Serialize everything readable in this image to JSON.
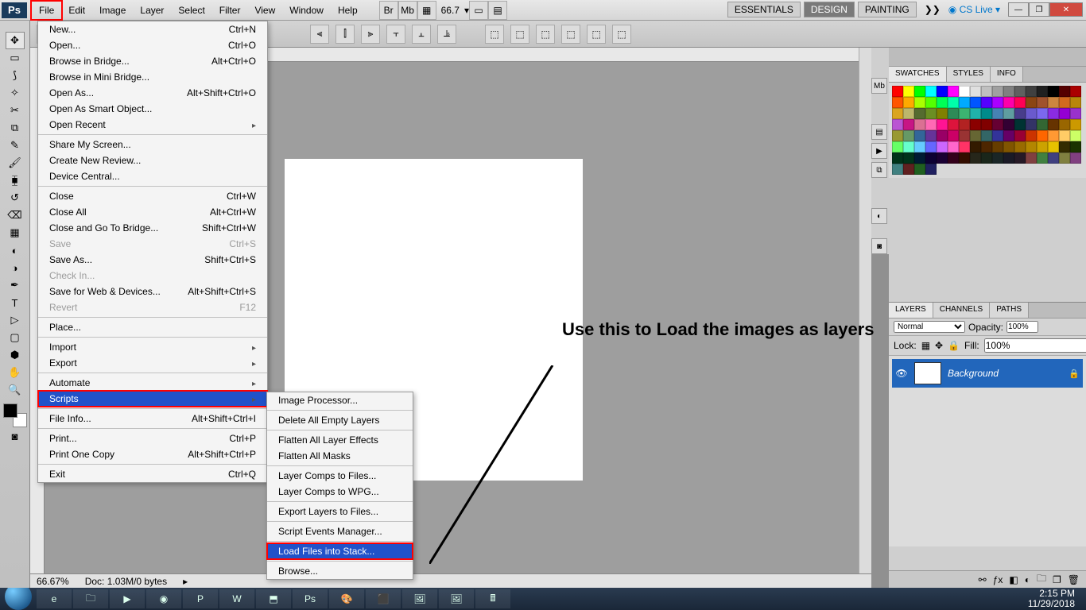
{
  "app": {
    "logo": "Ps"
  },
  "menu": [
    "File",
    "Edit",
    "Image",
    "Layer",
    "Select",
    "Filter",
    "View",
    "Window",
    "Help"
  ],
  "menu_highlight_index": 0,
  "toolbar_top": {
    "zoom": "66.7"
  },
  "workspaces": [
    "ESSENTIALS",
    "DESIGN",
    "PAINTING"
  ],
  "cslive": "CS Live",
  "file_menu": [
    {
      "label": "New...",
      "hotkey": "Ctrl+N"
    },
    {
      "label": "Open...",
      "hotkey": "Ctrl+O"
    },
    {
      "label": "Browse in Bridge...",
      "hotkey": "Alt+Ctrl+O"
    },
    {
      "label": "Browse in Mini Bridge..."
    },
    {
      "label": "Open As...",
      "hotkey": "Alt+Shift+Ctrl+O"
    },
    {
      "label": "Open As Smart Object..."
    },
    {
      "label": "Open Recent",
      "submenu": true
    },
    {
      "sep": true
    },
    {
      "label": "Share My Screen..."
    },
    {
      "label": "Create New Review..."
    },
    {
      "label": "Device Central..."
    },
    {
      "sep": true
    },
    {
      "label": "Close",
      "hotkey": "Ctrl+W"
    },
    {
      "label": "Close All",
      "hotkey": "Alt+Ctrl+W"
    },
    {
      "label": "Close and Go To Bridge...",
      "hotkey": "Shift+Ctrl+W"
    },
    {
      "label": "Save",
      "hotkey": "Ctrl+S",
      "disabled": true
    },
    {
      "label": "Save As...",
      "hotkey": "Shift+Ctrl+S"
    },
    {
      "label": "Check In...",
      "disabled": true
    },
    {
      "label": "Save for Web & Devices...",
      "hotkey": "Alt+Shift+Ctrl+S"
    },
    {
      "label": "Revert",
      "hotkey": "F12",
      "disabled": true
    },
    {
      "sep": true
    },
    {
      "label": "Place..."
    },
    {
      "sep": true
    },
    {
      "label": "Import",
      "submenu": true
    },
    {
      "label": "Export",
      "submenu": true
    },
    {
      "sep": true
    },
    {
      "label": "Automate",
      "submenu": true
    },
    {
      "label": "Scripts",
      "submenu": true,
      "highlight": true
    },
    {
      "sep": true
    },
    {
      "label": "File Info...",
      "hotkey": "Alt+Shift+Ctrl+I"
    },
    {
      "sep": true
    },
    {
      "label": "Print...",
      "hotkey": "Ctrl+P"
    },
    {
      "label": "Print One Copy",
      "hotkey": "Alt+Shift+Ctrl+P"
    },
    {
      "sep": true
    },
    {
      "label": "Exit",
      "hotkey": "Ctrl+Q"
    }
  ],
  "scripts_submenu": [
    {
      "label": "Image Processor..."
    },
    {
      "sep": true
    },
    {
      "label": "Delete All Empty Layers"
    },
    {
      "sep": true
    },
    {
      "label": "Flatten All Layer Effects"
    },
    {
      "label": "Flatten All Masks"
    },
    {
      "sep": true
    },
    {
      "label": "Layer Comps to Files..."
    },
    {
      "label": "Layer Comps to WPG..."
    },
    {
      "sep": true
    },
    {
      "label": "Export Layers to Files..."
    },
    {
      "sep": true
    },
    {
      "label": "Script Events Manager..."
    },
    {
      "sep": true
    },
    {
      "label": "Load Files into Stack...",
      "highlight": true
    },
    {
      "sep": true
    },
    {
      "label": "Browse..."
    }
  ],
  "annotation": "Use this to Load the images as layers",
  "panels": {
    "swatches_tabs": [
      "SWATCHES",
      "STYLES",
      "INFO"
    ],
    "layers_tabs": [
      "LAYERS",
      "CHANNELS",
      "PATHS"
    ],
    "blend": "Normal",
    "opacity_label": "Opacity:",
    "opacity": "100%",
    "lock_label": "Lock:",
    "fill_label": "Fill:",
    "fill": "100%",
    "bg_layer": "Background"
  },
  "swatch_colors": [
    "#ff0000",
    "#ffff00",
    "#00ff00",
    "#00ffff",
    "#0000ff",
    "#ff00ff",
    "#ffffff",
    "#e0e0e0",
    "#c0c0c0",
    "#a0a0a0",
    "#808080",
    "#606060",
    "#404040",
    "#202020",
    "#000000",
    "#550000",
    "#aa0000",
    "#ff5500",
    "#ffaa00",
    "#aaff00",
    "#55ff00",
    "#00ff55",
    "#00ffaa",
    "#00aaff",
    "#0055ff",
    "#5500ff",
    "#aa00ff",
    "#ff00aa",
    "#ff0055",
    "#8b4513",
    "#a0522d",
    "#cd853f",
    "#d2691e",
    "#b8860b",
    "#daa520",
    "#bdb76b",
    "#556b2f",
    "#6b8e23",
    "#808000",
    "#2e8b57",
    "#3cb371",
    "#20b2aa",
    "#008b8b",
    "#4682b4",
    "#5f9ea0",
    "#483d8b",
    "#6a5acd",
    "#7b68ee",
    "#8a2be2",
    "#9400d3",
    "#9932cc",
    "#ba55d3",
    "#c71585",
    "#db7093",
    "#ff69b4",
    "#ff1493",
    "#dc143c",
    "#b22222",
    "#8b0000",
    "#800000",
    "#660033",
    "#330033",
    "#003333",
    "#333366",
    "#336633",
    "#663300",
    "#996600",
    "#cc9900",
    "#999933",
    "#669966",
    "#336699",
    "#663399",
    "#990066",
    "#cc0066",
    "#993333",
    "#666633",
    "#336666",
    "#333399",
    "#660066",
    "#990033",
    "#cc3300",
    "#ff6600",
    "#ff9933",
    "#ffcc66",
    "#ccff66",
    "#66ff66",
    "#66ffcc",
    "#66ccff",
    "#6666ff",
    "#cc66ff",
    "#ff66cc",
    "#ff3366",
    "#331a00",
    "#4d2600",
    "#663d00",
    "#805500",
    "#996b00",
    "#b38600",
    "#cca300",
    "#e6c200",
    "#332b00",
    "#1a3300",
    "#003319",
    "#00331a",
    "#001a33",
    "#0d0033",
    "#1a0033",
    "#33001a",
    "#330d00",
    "#26261a",
    "#1a261a",
    "#1a2626",
    "#1a1a26",
    "#261a26",
    "#804040",
    "#408040",
    "#404080",
    "#808040",
    "#804080",
    "#408080",
    "#602020",
    "#206020",
    "#202060"
  ],
  "status": {
    "zoom": "66.67%",
    "doc": "Doc: 1.03M/0 bytes"
  },
  "taskbar": {
    "time": "2:15 PM",
    "date": "11/29/2018"
  }
}
